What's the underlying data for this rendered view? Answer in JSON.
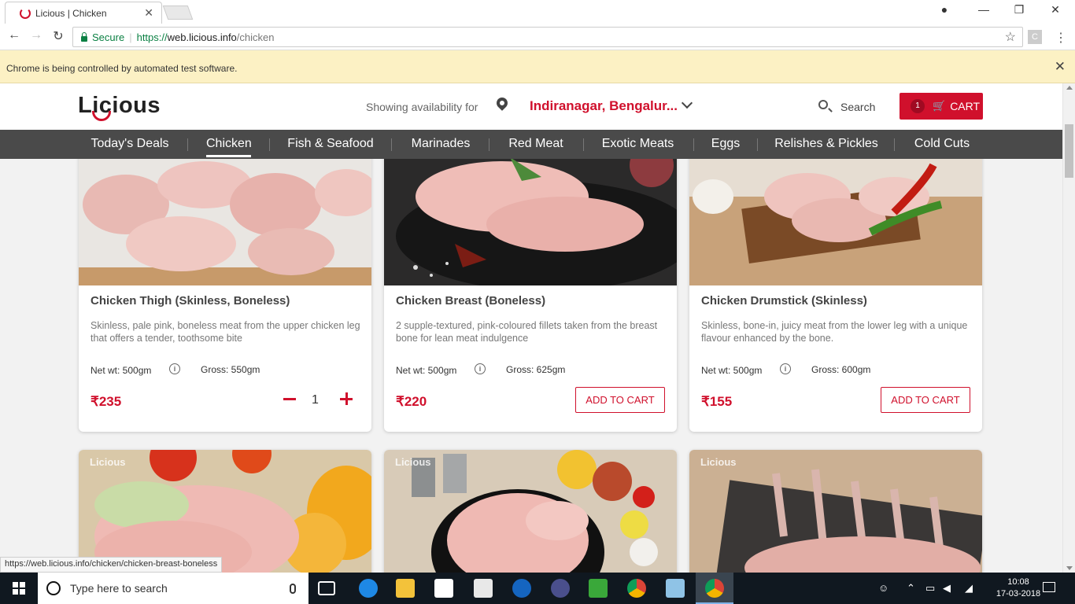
{
  "browser": {
    "tab_title": "Licious | Chicken",
    "tab_close": "✕",
    "secure_label": "Secure",
    "url_proto": "https://",
    "url_host": "web.licious.info",
    "url_path": "/chicken",
    "ext_label": "C",
    "infobar_text": "Chrome is being controlled by automated test software.",
    "status_url": "https://web.licious.info/chicken/chicken-breast-boneless"
  },
  "header": {
    "logo_text": "Licious",
    "availability_label": "Showing availability for",
    "location": "Indiranagar, Bengalur...",
    "search_label": "Search",
    "cart_count": "1",
    "cart_label": "CART",
    "brand_color": "#d0102c"
  },
  "categories": [
    {
      "label": "Today's Deals"
    },
    {
      "label": "Chicken"
    },
    {
      "label": "Fish & Seafood"
    },
    {
      "label": "Marinades"
    },
    {
      "label": "Red Meat"
    },
    {
      "label": "Exotic Meats"
    },
    {
      "label": "Eggs"
    },
    {
      "label": "Relishes & Pickles"
    },
    {
      "label": "Cold Cuts"
    }
  ],
  "active_category": "Chicken",
  "products": [
    {
      "name": "Chicken Thigh (Skinless, Boneless)",
      "description": "Skinless, pale pink, boneless meat from the upper chicken leg that offers a tender, toothsome bite",
      "net_wt": "Net wt: 500gm",
      "gross": "Gross: 550gm",
      "price": "₹235",
      "quantity": "1"
    },
    {
      "name": "Chicken Breast (Boneless)",
      "description": "2 supple-textured, pink-coloured fillets taken from the breast bone for lean meat indulgence",
      "net_wt": "Net wt: 500gm",
      "gross": "Gross: 625gm",
      "price": "₹220",
      "button": "ADD TO CART"
    },
    {
      "name": "Chicken Drumstick (Skinless)",
      "description": "Skinless, bone-in, juicy meat from the lower leg with a unique flavour enhanced by the bone.",
      "net_wt": "Net wt: 500gm",
      "gross": "Gross: 600gm",
      "price": "₹155",
      "button": "ADD TO CART"
    }
  ],
  "second_row_watermarks": [
    "Licious",
    "Licious",
    "Licious"
  ],
  "taskbar": {
    "search_placeholder": "Type here to search",
    "time": "10:08",
    "date": "17-03-2018"
  }
}
